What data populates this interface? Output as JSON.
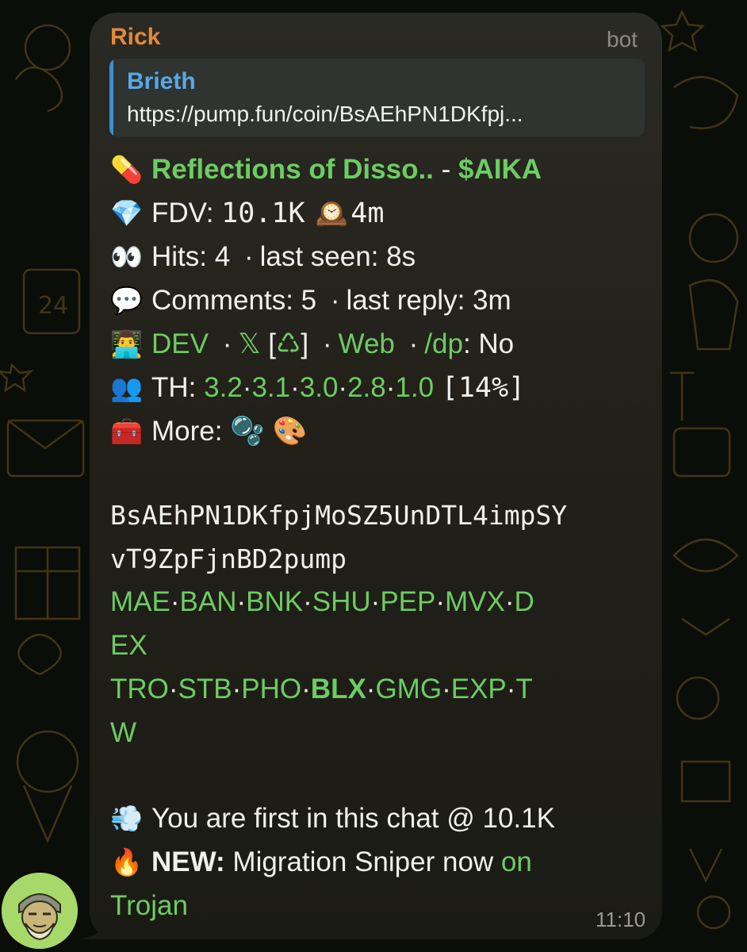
{
  "message": {
    "sender": "Rick",
    "sender_tag": "bot",
    "time": "11:10",
    "reply": {
      "name": "Brieth",
      "text": "https://pump.fun/coin/BsAEhPN1DKfpj..."
    },
    "token_line": {
      "name": "Reflections of Disso..",
      "dash": "-",
      "ticker": "$AIKA"
    },
    "fdv_line": {
      "label": "FDV:",
      "value": "10.1K",
      "age": "4m"
    },
    "hits_line": {
      "hits": "Hits: 4",
      "dot": "·",
      "last_seen": "last seen: 8s"
    },
    "comments_line": {
      "comments": "Comments: 5",
      "dot": "·",
      "last_reply": "last reply: 3m"
    },
    "dev_line": {
      "dev": "DEV",
      "dot": "·",
      "x": "𝕏",
      "recycle_open": "[",
      "recycle": "♺",
      "recycle_close": "]",
      "web": "Web",
      "dp": "/dp",
      "dp_value": ": No"
    },
    "th_line": {
      "label": "TH:",
      "values": [
        "3.2",
        "3.1",
        "3.0",
        "2.8",
        "1.0"
      ],
      "sep": "·",
      "percent": "[14%]"
    },
    "more_line": {
      "label": "More:"
    },
    "contract": {
      "line1": "BsAEhPN1DKfpjMoSZ5UnDTL4impSY",
      "line2": "vT9ZpFjnBD2pump"
    },
    "bots_row1": {
      "items": [
        "MAE",
        "BAN",
        "BNK",
        "SHU",
        "PEP",
        "MVX"
      ],
      "tail": "D",
      "wrap": "EX",
      "sep": "·"
    },
    "bots_row2": {
      "items": [
        "TRO",
        "STB",
        "PHO",
        "BLX",
        "GMG",
        "EXP"
      ],
      "tail": "T",
      "wrap": "W",
      "sep": "·"
    },
    "first_line": "You are first in this chat @ 10.1K",
    "new_line": {
      "label": "NEW:",
      "text": " Migration Sniper now ",
      "link1": "on",
      "link2": "Trojan"
    }
  },
  "colors": {
    "link": "#6dcc63",
    "sender": "#e2893a",
    "reply_accent": "#3d8fd4",
    "bubble": "#24231d"
  },
  "icons": [
    "pill-emoji",
    "gem-emoji",
    "mantel-clock-emoji",
    "eyes-emoji",
    "speech-balloon-emoji",
    "technologist-emoji",
    "busts-emoji",
    "toolbox-emoji",
    "bubbles-emoji",
    "palette-emoji",
    "dash-emoji",
    "fire-emoji"
  ]
}
